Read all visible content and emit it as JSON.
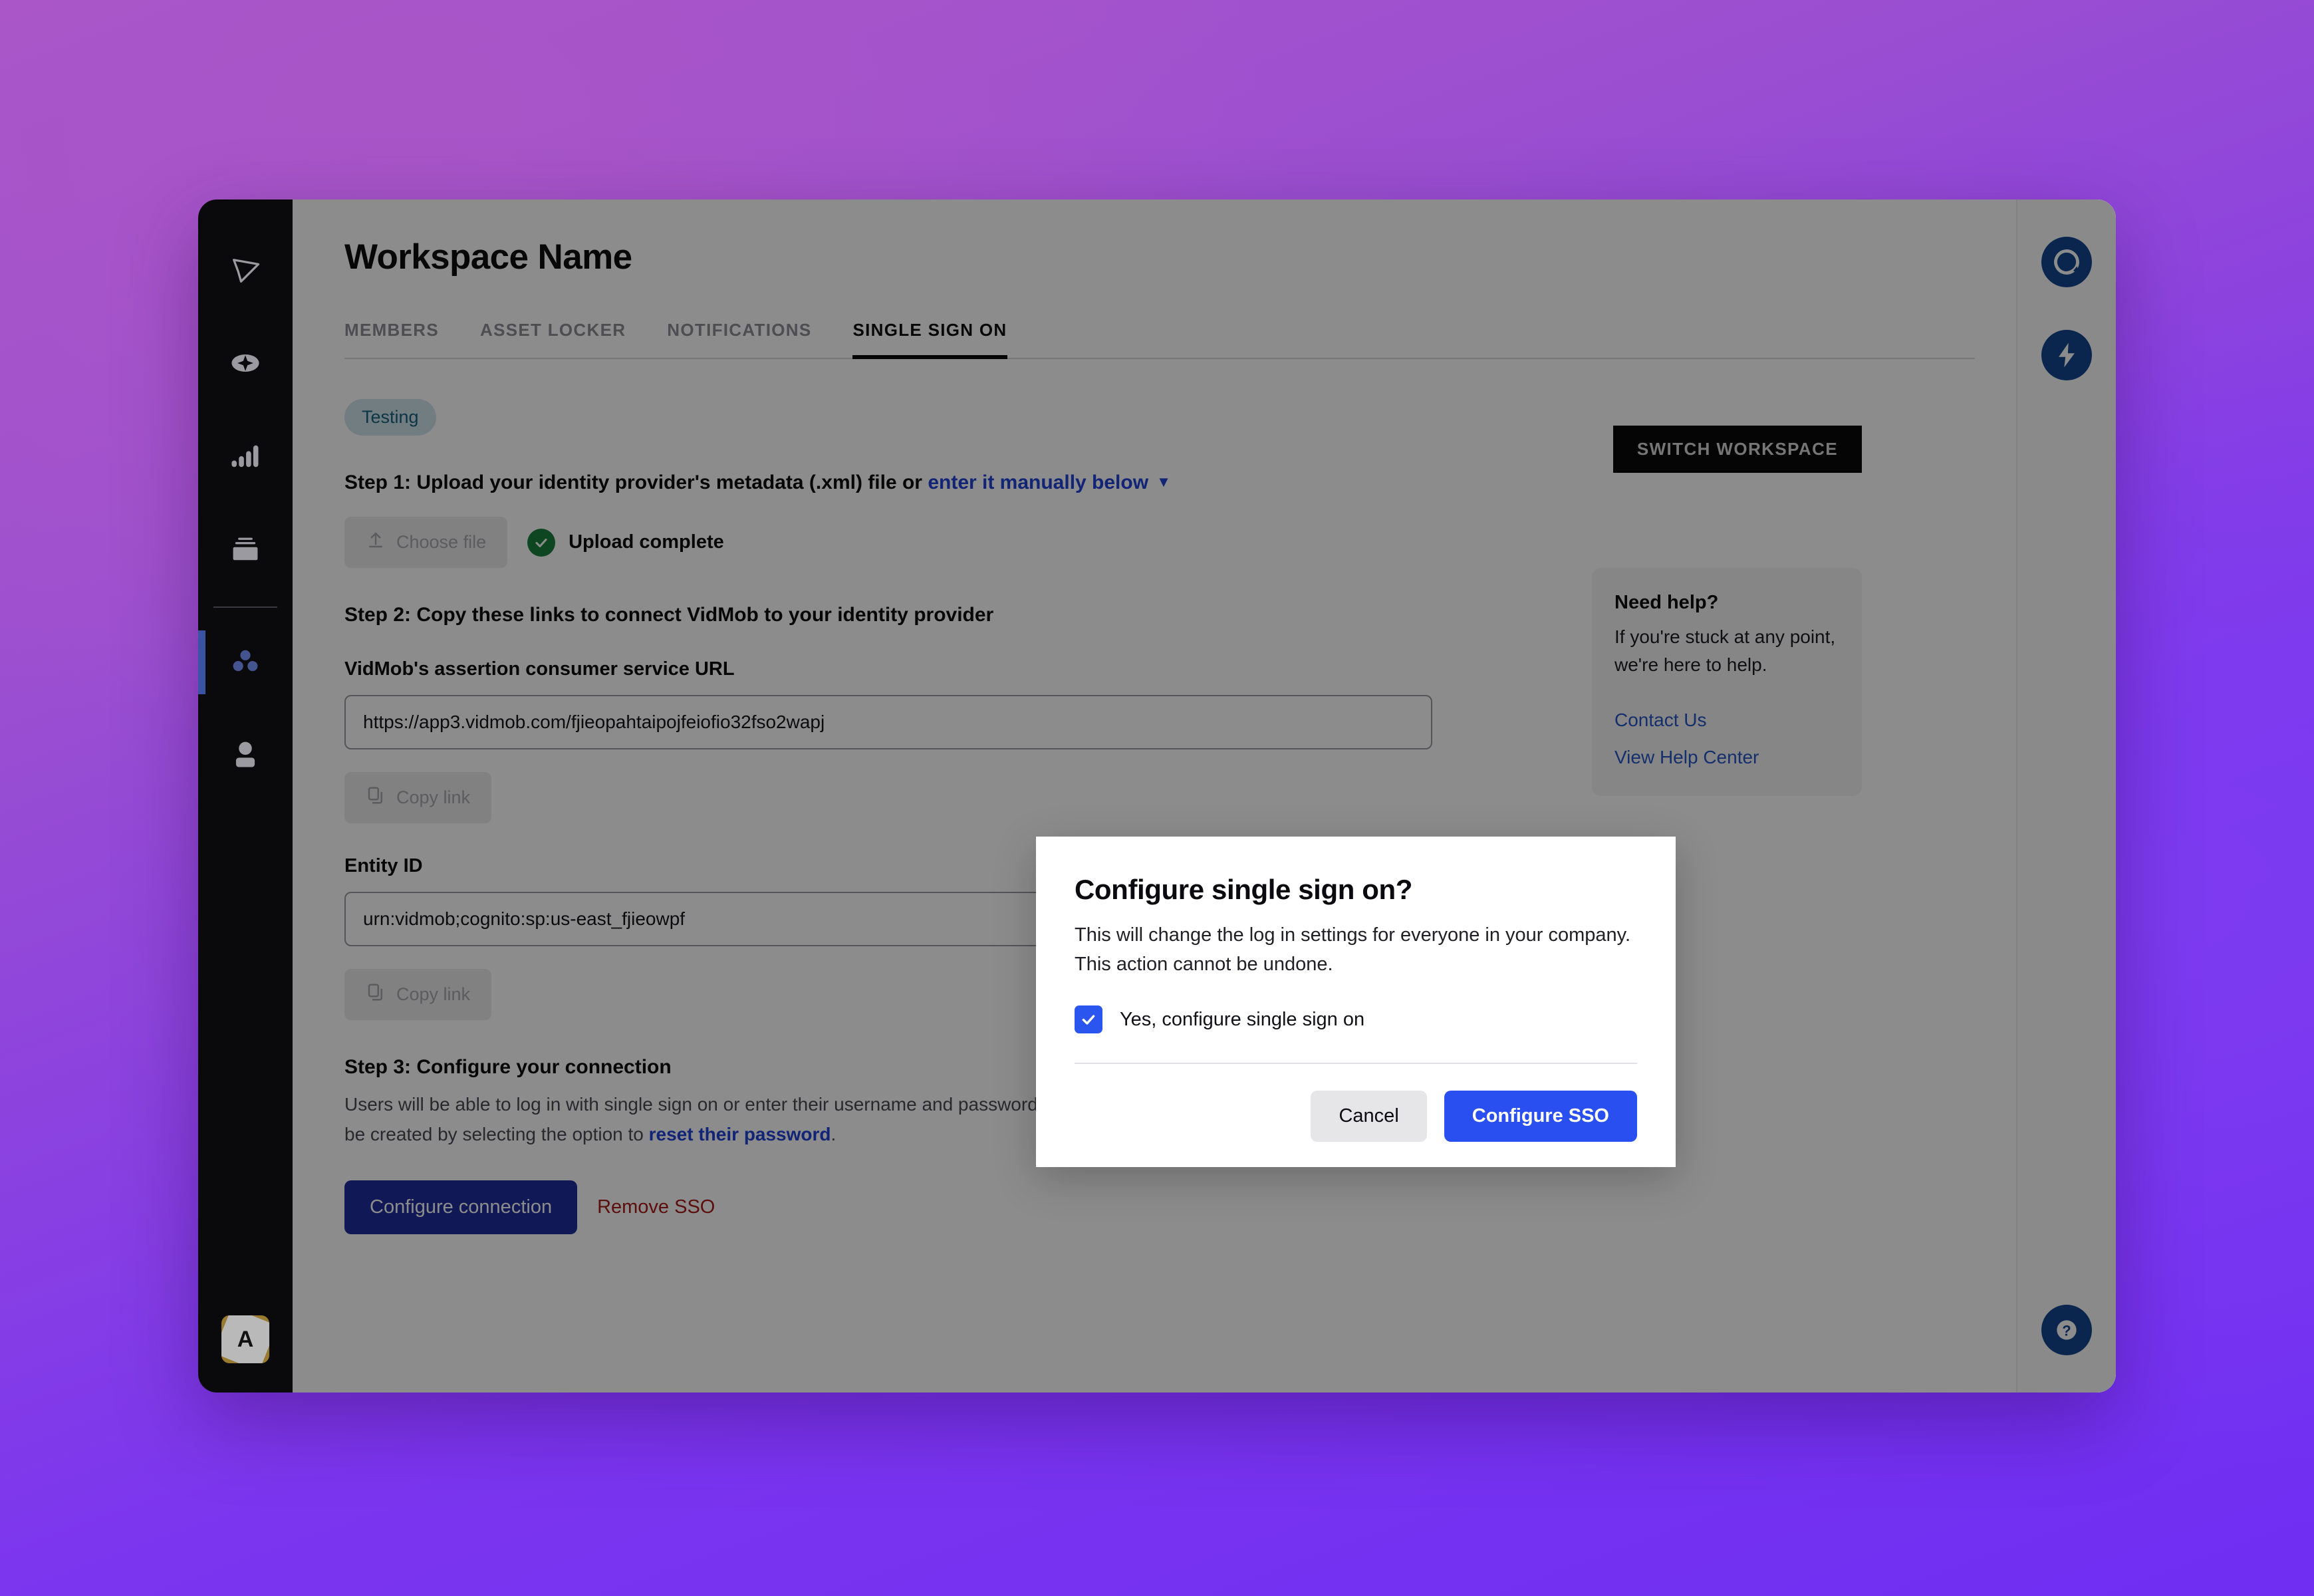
{
  "app": {
    "page_title": "Workspace Name",
    "switch_workspace_label": "SWITCH WORKSPACE"
  },
  "sidebar": {
    "items": [
      {
        "icon": "cursor-arrow-icon",
        "name": "home"
      },
      {
        "icon": "sparkle-eye-icon",
        "name": "create"
      },
      {
        "icon": "bar-chart-icon",
        "name": "analytics"
      },
      {
        "icon": "archive-box-icon",
        "name": "library"
      },
      {
        "icon": "three-dots-icon",
        "name": "workspace-settings"
      },
      {
        "icon": "person-icon",
        "name": "members"
      }
    ],
    "avatar_initial": "A"
  },
  "tabs": [
    {
      "label": "MEMBERS",
      "active": false
    },
    {
      "label": "ASSET LOCKER",
      "active": false
    },
    {
      "label": "NOTIFICATIONS",
      "active": false
    },
    {
      "label": "SINGLE SIGN ON",
      "active": true
    }
  ],
  "status_badge": "Testing",
  "step1": {
    "heading_prefix": "Step 1: Upload your identity provider's metadata (.xml) file or",
    "manual_link": "enter it manually below",
    "choose_file_label": "Choose file",
    "upload_status": "Upload complete"
  },
  "step2": {
    "heading": "Step 2: Copy these links to connect VidMob to your identity provider",
    "acs_label": "VidMob's assertion consumer service URL",
    "acs_value": "https://app3.vidmob.com/fjieopahtaipojfeiofio32fso2wapj",
    "acs_copy_label": "Copy link",
    "entity_label": "Entity ID",
    "entity_value": "urn:vidmob;cognito:sp:us-east_fjieowpf",
    "entity_copy_label": "Copy link"
  },
  "step3": {
    "heading": "Step 3: Configure your connection",
    "body_before": "Users will be able to log in with single sign on or enter their username and password, which can be created by selecting the option to",
    "body_link": "reset their password",
    "body_after": ".",
    "configure_label": "Configure connection",
    "remove_label": "Remove SSO"
  },
  "help_card": {
    "title": "Need help?",
    "body": "If you're stuck at any point, we're here to help.",
    "contact_link": "Contact Us",
    "help_center_link": "View Help Center"
  },
  "right_rail": {
    "chat_icon": "chat-bubble-icon",
    "bolt_icon": "lightning-bolt-icon",
    "help_icon": "question-mark-icon"
  },
  "modal": {
    "title": "Configure single sign on?",
    "description": "This will change the log in settings for everyone in your company. This action cannot be undone.",
    "checkbox_label": "Yes, configure single sign on",
    "checkbox_checked": true,
    "cancel_label": "Cancel",
    "confirm_label": "Configure SSO"
  },
  "colors": {
    "primary_blue": "#2a4ff0",
    "dark_blue": "#1e2f9c",
    "link_blue": "#2142d6",
    "danger_red": "#a81a1a",
    "success_green": "#18803c",
    "badge_bg": "#cfe4ec",
    "badge_text": "#16627f",
    "rail_blue": "#14468f"
  }
}
